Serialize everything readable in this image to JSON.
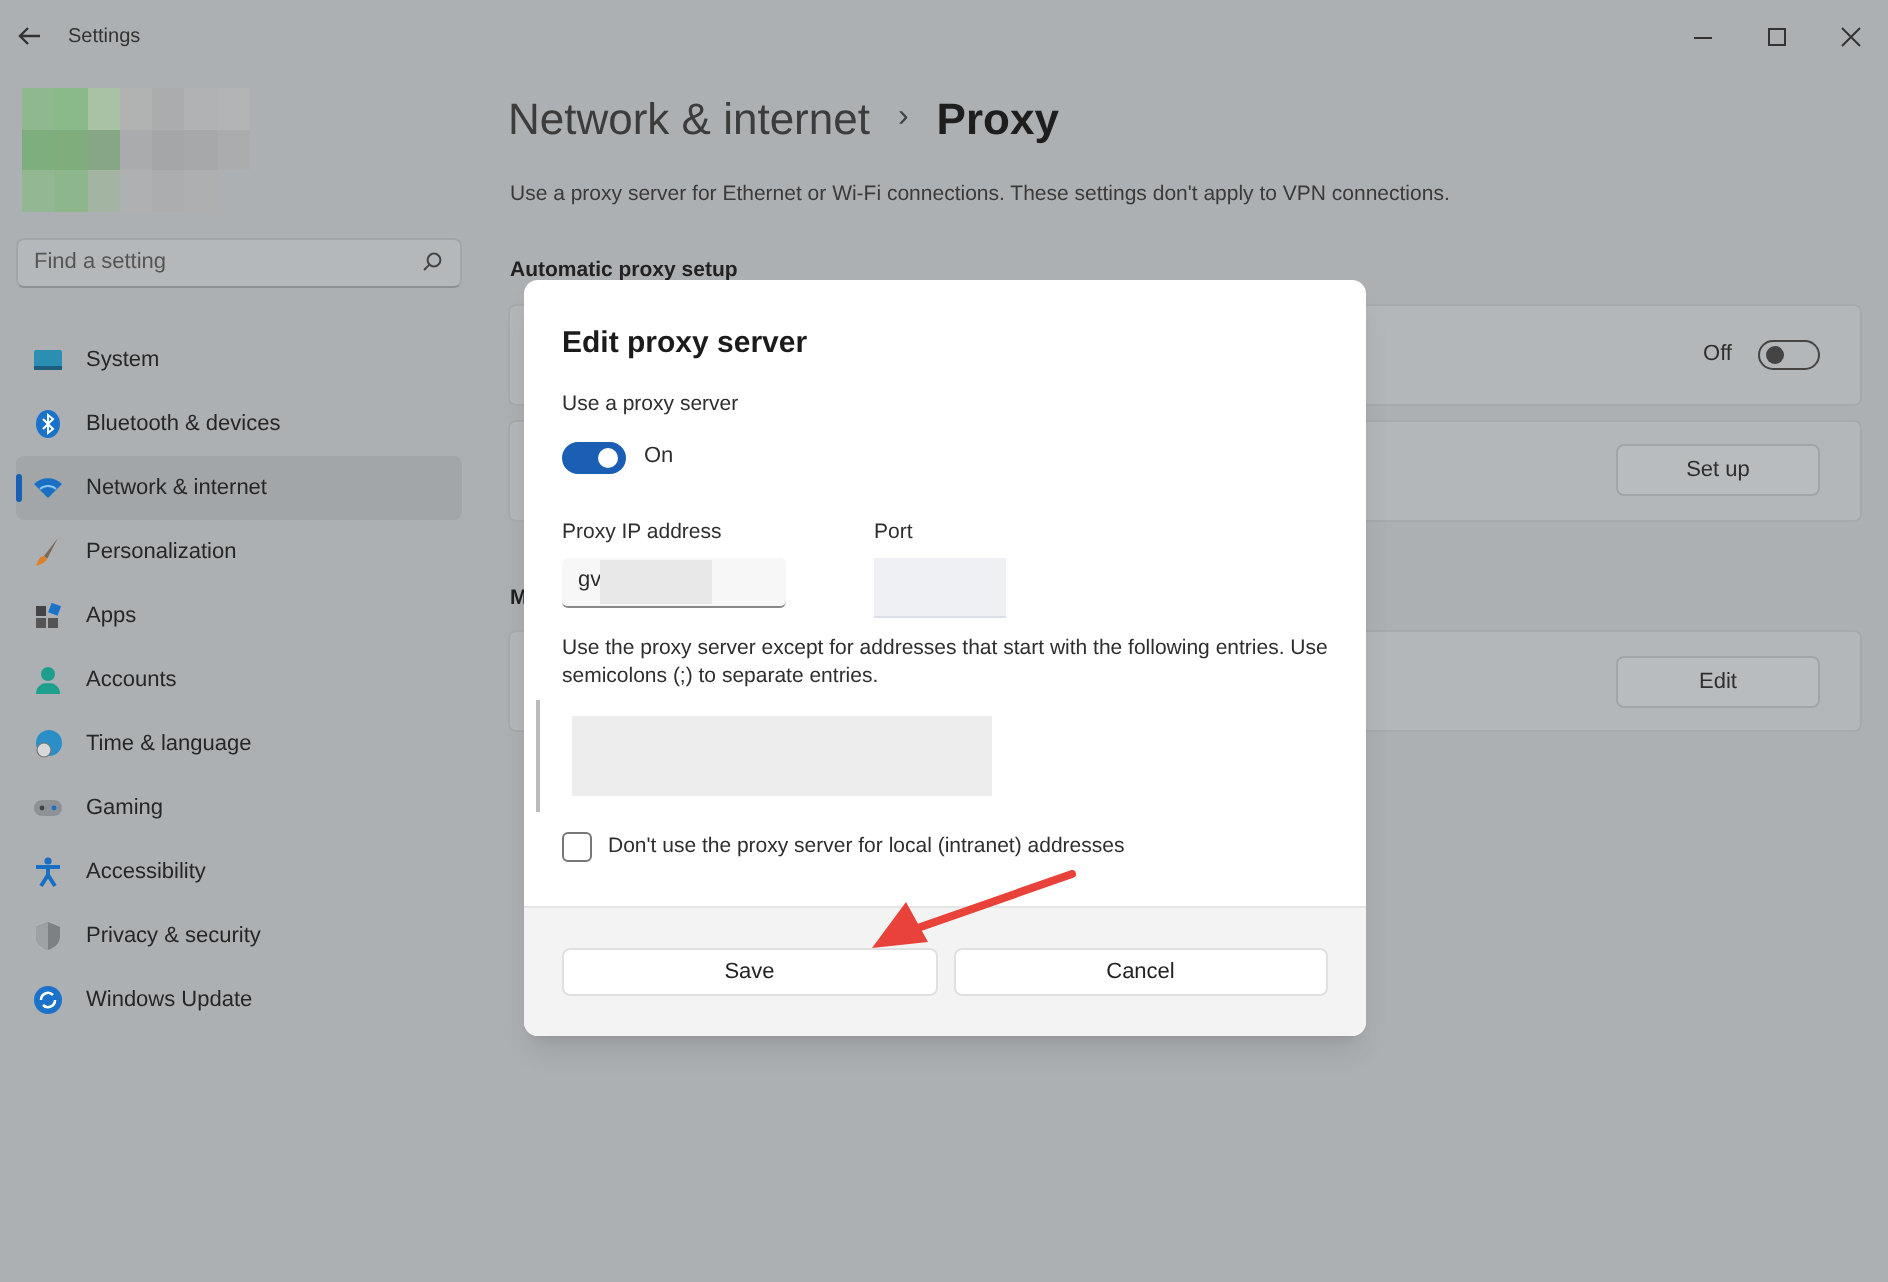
{
  "window": {
    "title": "Settings"
  },
  "search": {
    "placeholder": "Find a setting"
  },
  "sidebar": {
    "items": [
      {
        "label": "System",
        "selected": false
      },
      {
        "label": "Bluetooth & devices",
        "selected": false
      },
      {
        "label": "Network & internet",
        "selected": true
      },
      {
        "label": "Personalization",
        "selected": false
      },
      {
        "label": "Apps",
        "selected": false
      },
      {
        "label": "Accounts",
        "selected": false
      },
      {
        "label": "Time & language",
        "selected": false
      },
      {
        "label": "Gaming",
        "selected": false
      },
      {
        "label": "Accessibility",
        "selected": false
      },
      {
        "label": "Privacy & security",
        "selected": false
      },
      {
        "label": "Windows Update",
        "selected": false
      }
    ]
  },
  "breadcrumb": {
    "parent": "Network & internet",
    "separator": "›",
    "current": "Proxy"
  },
  "description": "Use a proxy server for Ethernet or Wi-Fi connections. These settings don't apply to VPN connections.",
  "sections": [
    {
      "heading": "Automatic proxy setup",
      "cards": [
        {
          "kind": "toggle",
          "state_label": "Off",
          "on": false
        },
        {
          "kind": "button",
          "button": "Set up"
        }
      ]
    },
    {
      "heading": "M",
      "cards": [
        {
          "kind": "button",
          "button": "Edit"
        }
      ]
    }
  ],
  "dialog": {
    "title": "Edit proxy server",
    "use_proxy": {
      "label": "Use a proxy server",
      "on": true,
      "state_label": "On"
    },
    "ip": {
      "label": "Proxy IP address",
      "value": "gv"
    },
    "port": {
      "label": "Port"
    },
    "exceptions": {
      "label": "Use the proxy server except for addresses that start with the following entries. Use semicolons (;) to separate entries."
    },
    "local": {
      "label": "Don't use the proxy server for local (intranet) addresses",
      "checked": false
    },
    "buttons": [
      "Save",
      "Cancel"
    ]
  }
}
